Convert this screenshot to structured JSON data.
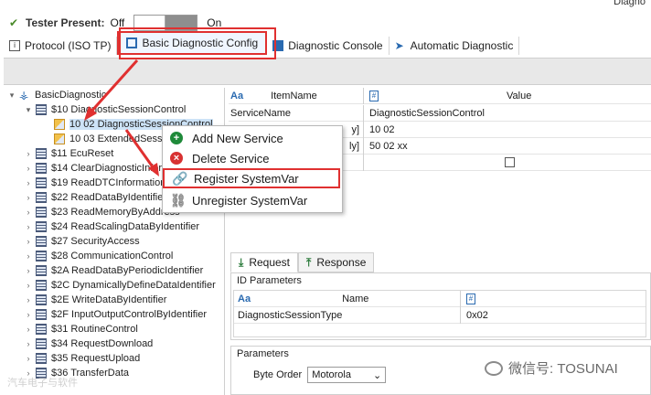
{
  "window": {
    "title": "Diagno"
  },
  "tester_present": {
    "label": "Tester Present:",
    "off": "Off",
    "on": "On"
  },
  "tabs": [
    {
      "label": "Protocol (ISO TP)"
    },
    {
      "label": "Basic Diagnostic Config"
    },
    {
      "label": "Diagnostic Console"
    },
    {
      "label": "Automatic Diagnostic"
    }
  ],
  "tree": {
    "root": "BasicDiagnostic",
    "items": [
      "$10 DiagnosticSessionControl",
      "10 02 DiagnosticSessionControl",
      "10 03 ExtendedSession",
      "$11 EcuReset",
      "$14 ClearDiagnosticInformation",
      "$19 ReadDTCInformation",
      "$22 ReadDataByIdentifier",
      "$23 ReadMemoryByAddress",
      "$24 ReadScalingDataByIdentifier",
      "$27 SecurityAccess",
      "$28 CommunicationControl",
      "$2A ReadDataByPeriodicIdentifier",
      "$2C DynamicallyDefineDataIdentifier",
      "$2E WriteDataByIdentifier",
      "$2F InputOutputControlByIdentifier",
      "$31 RoutineControl",
      "$34 RequestDownload",
      "$35 RequestUpload",
      "$36 TransferData"
    ]
  },
  "grid": {
    "col_name": "ItemName",
    "col_value": "Value",
    "rows": [
      {
        "name": "ServiceName",
        "value": "DiagnosticSessionControl"
      },
      {
        "name": "y]",
        "value": "10 02"
      },
      {
        "name": "ly]",
        "value": "50 02 xx"
      }
    ]
  },
  "context_menu": {
    "items": [
      "Add New Service",
      "Delete Service",
      "Register SystemVar",
      "Unregister SystemVar"
    ]
  },
  "subtabs": {
    "request": "Request",
    "response": "Response"
  },
  "id_parameters": {
    "title": "ID Parameters",
    "col_name": "Name",
    "row_name": "DiagnosticSessionType",
    "row_value": "0x02"
  },
  "parameters": {
    "title": "Parameters",
    "byte_order_label": "Byte Order",
    "byte_order_value": "Motorola"
  },
  "watermark": {
    "left": "汽车电子与软件",
    "right": "微信号: TOSUNAI"
  },
  "colors": {
    "highlight": "#e03030",
    "accent": "#2a6ab0",
    "selection": "#cde3f7"
  }
}
